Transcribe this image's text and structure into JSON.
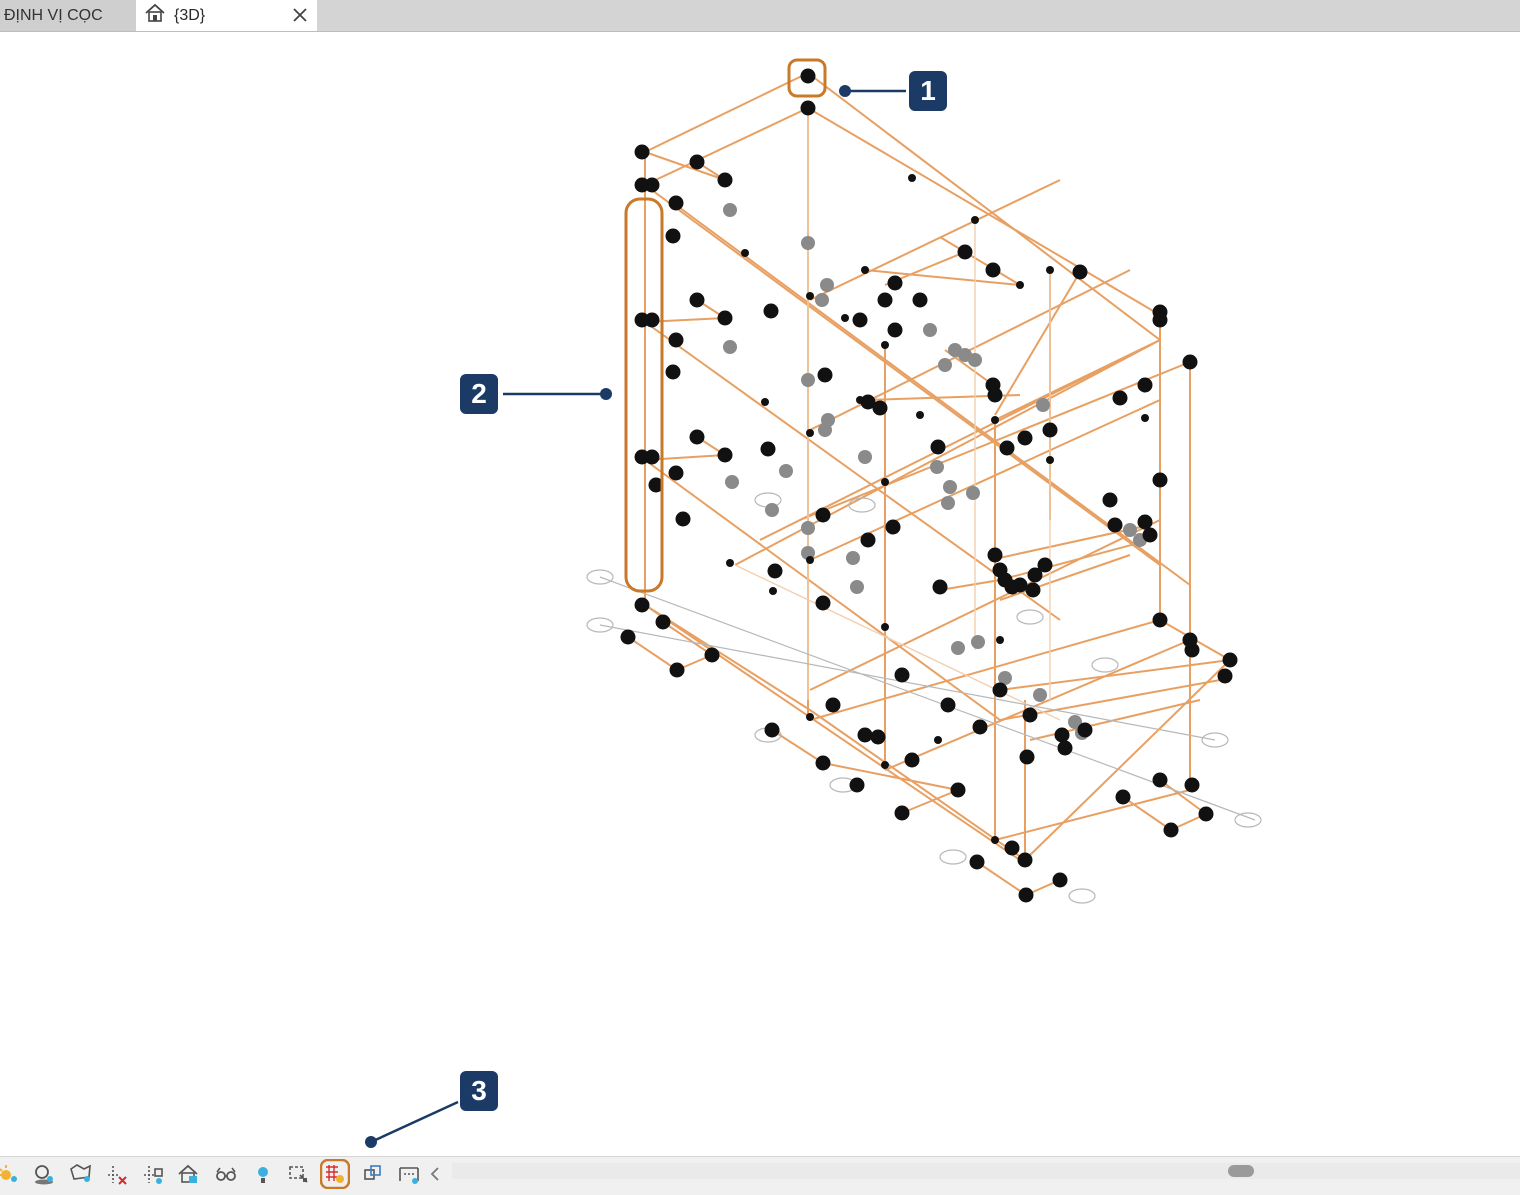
{
  "tabs": [
    {
      "label": "ĐỊNH VỊ CỌC",
      "active": false
    },
    {
      "label": "{3D}",
      "active": true,
      "icon": "house-3d-icon"
    }
  ],
  "callouts": [
    "1",
    "2",
    "3"
  ],
  "statusbar": {
    "icons": [
      "sun-path-icon",
      "shadows-icon",
      "crop-region-icon",
      "temporary-hide-icon",
      "reveal-hidden-icon",
      "home-view-icon",
      "view-glasses-icon",
      "light-bulb-icon",
      "analytical-model-icon",
      "highlight-displacement-icon",
      "show-constraints-icon",
      "reveal-constraints-icon"
    ]
  },
  "colors": {
    "model_lines": "#e8a062",
    "callout": "#1c3a66",
    "highlight": "#c8792a",
    "nodes": "#111111"
  }
}
